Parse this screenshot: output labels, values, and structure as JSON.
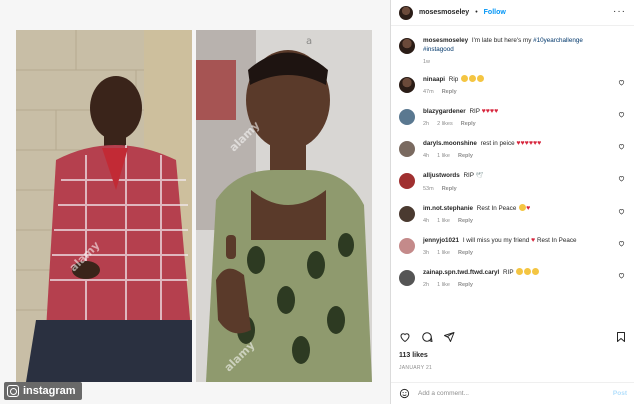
{
  "header": {
    "username": "mosesmoseley",
    "separator": "•",
    "follow_label": "Follow",
    "more_icon": "more-horizontal-icon"
  },
  "caption": {
    "username": "mosesmoseley",
    "text": "I'm late but here's my",
    "hashtags": "#10yearchallenge #instagood",
    "time": "1w"
  },
  "comments": [
    {
      "username": "ninaapi",
      "text": "Rip",
      "emoji": [
        "sad-emoji",
        "sad-emoji",
        "sad-emoji"
      ],
      "time": "47m",
      "likes": "",
      "reply": "Reply"
    },
    {
      "username": "blazygardener",
      "text": "RIP",
      "emoji": [
        "red-heart",
        "red-heart",
        "red-heart",
        "red-heart"
      ],
      "time": "2h",
      "likes": "2 likes",
      "reply": "Reply"
    },
    {
      "username": "daryls.moonshine",
      "text": "rest in peice",
      "emoji": [
        "red-heart",
        "red-heart",
        "red-heart",
        "red-heart",
        "red-heart",
        "red-heart"
      ],
      "time": "4h",
      "likes": "1 like",
      "reply": "Reply"
    },
    {
      "username": "alljustwords",
      "text": "RIP",
      "emoji": [
        "dove-emoji"
      ],
      "time": "53m",
      "likes": "",
      "reply": "Reply"
    },
    {
      "username": "im.not.stephanie",
      "text": "Rest In Peace",
      "emoji": [
        "sad-emoji",
        "red-heart"
      ],
      "time": "4h",
      "likes": "1 like",
      "reply": "Reply"
    },
    {
      "username": "jennyjo1021",
      "text": "I will miss you my friend",
      "emoji_mid": "red-heart",
      "text2": "Rest In Peace",
      "time": "3h",
      "likes": "1 like",
      "reply": "Reply"
    },
    {
      "username": "zainap.spn.twd.ftwd.caryl",
      "text": "RIP",
      "emoji": [
        "sad-emoji",
        "sad-emoji",
        "sad-emoji"
      ],
      "time": "2h",
      "likes": "1 like",
      "reply": "Reply"
    }
  ],
  "actions": {
    "like_icon": "heart-icon",
    "comment_icon": "comment-icon",
    "share_icon": "share-icon",
    "save_icon": "bookmark-icon"
  },
  "likes_text": "113 likes",
  "date_text": "JANUARY 21",
  "add_comment": {
    "emoji_icon": "smiley-icon",
    "placeholder": "Add a comment...",
    "post_label": "Post"
  },
  "media": {
    "watermark_text": "alamy",
    "badge_label": "instagram"
  },
  "colors": {
    "link_blue": "#0095f6",
    "hashtag": "#00376b",
    "muted": "#8e8e8e",
    "heart_red": "#d7263d"
  }
}
